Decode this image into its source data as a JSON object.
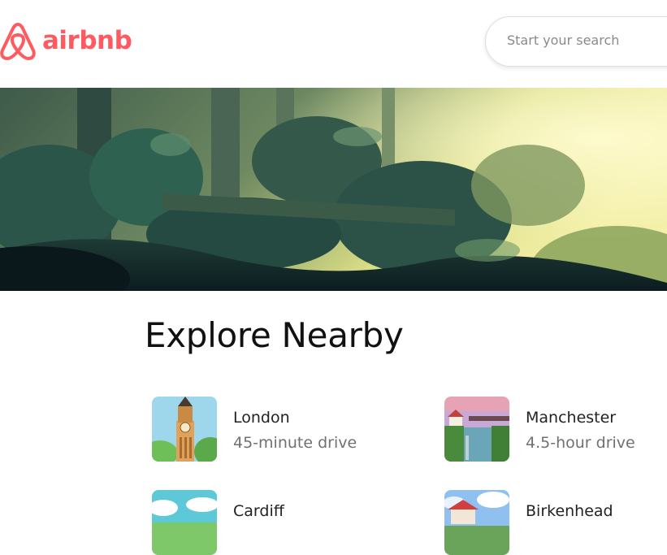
{
  "header": {
    "brand": "airbnb",
    "brand_color": "#FF5A5F",
    "logo_icon": "airbnb-belo-icon",
    "search_placeholder": "Start your search"
  },
  "hero": {
    "image": "forest-illustration"
  },
  "explore": {
    "title": "Explore Nearby",
    "items": [
      {
        "city": "London",
        "distance": "45-minute drive",
        "thumb": "big-ben-illustration"
      },
      {
        "city": "Manchester",
        "distance": "4.5-hour drive",
        "thumb": "canal-bridge-illustration"
      },
      {
        "city": "Cardiff",
        "distance": "",
        "thumb": "sky-clouds-illustration"
      },
      {
        "city": "Birkenhead",
        "distance": "",
        "thumb": "sky-house-illustration"
      }
    ]
  }
}
